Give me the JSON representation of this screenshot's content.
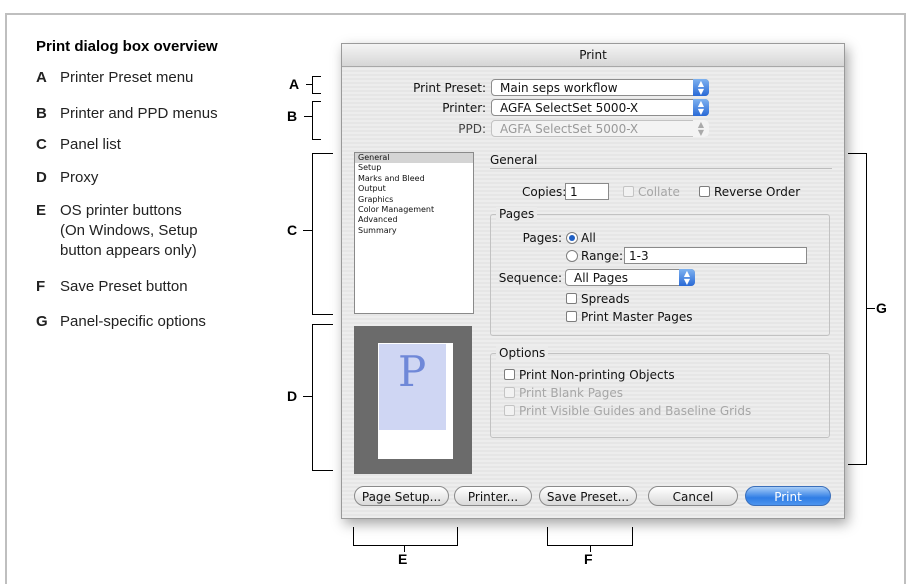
{
  "legend": {
    "title": "Print dialog box overview",
    "items": [
      {
        "key": "A",
        "lines": [
          "Printer Preset menu"
        ]
      },
      {
        "key": "B",
        "lines": [
          "Printer and PPD menus"
        ]
      },
      {
        "key": "C",
        "lines": [
          "Panel list"
        ]
      },
      {
        "key": "D",
        "lines": [
          "Proxy"
        ]
      },
      {
        "key": "E",
        "lines": [
          "OS printer buttons",
          "(On Windows, Setup",
          "button appears only)"
        ]
      },
      {
        "key": "F",
        "lines": [
          "Save Preset button"
        ]
      },
      {
        "key": "G",
        "lines": [
          "Panel-specific options"
        ]
      }
    ]
  },
  "dialog": {
    "title": "Print",
    "print_preset": {
      "label": "Print Preset:",
      "value": "Main seps workflow"
    },
    "printer": {
      "label": "Printer:",
      "value": "AGFA SelectSet 5000-X"
    },
    "ppd": {
      "label": "PPD:",
      "value": "AGFA SelectSet 5000-X"
    },
    "panel_list": [
      "General",
      "Setup",
      "Marks and Bleed",
      "Output",
      "Graphics",
      "Color Management",
      "Advanced",
      "Summary"
    ],
    "selected_panel": "General",
    "proxy_letter": "P",
    "section_title": "General",
    "copies": {
      "label": "Copies:",
      "value": "1"
    },
    "collate": "Collate",
    "reverse_order": "Reverse Order",
    "pages_group": {
      "title": "Pages",
      "pages_label": "Pages:",
      "all": "All",
      "range": "Range:",
      "range_value": "1-3",
      "sequence_label": "Sequence:",
      "sequence_value": "All Pages",
      "spreads": "Spreads",
      "print_master_pages": "Print Master Pages"
    },
    "options_group": {
      "title": "Options",
      "print_nonprinting": "Print Non-printing Objects",
      "print_blank": "Print Blank Pages",
      "print_guides": "Print Visible Guides and Baseline Grids"
    },
    "buttons": {
      "page_setup": "Page Setup...",
      "printer": "Printer...",
      "save_preset": "Save Preset...",
      "cancel": "Cancel",
      "print": "Print"
    }
  },
  "callouts": {
    "A": "A",
    "B": "B",
    "C": "C",
    "D": "D",
    "E": "E",
    "F": "F",
    "G": "G"
  },
  "colors": {
    "accent": "#2f7de5",
    "proxy_bg": "#6b6b6b",
    "proxy_area": "#cfd6f3"
  }
}
